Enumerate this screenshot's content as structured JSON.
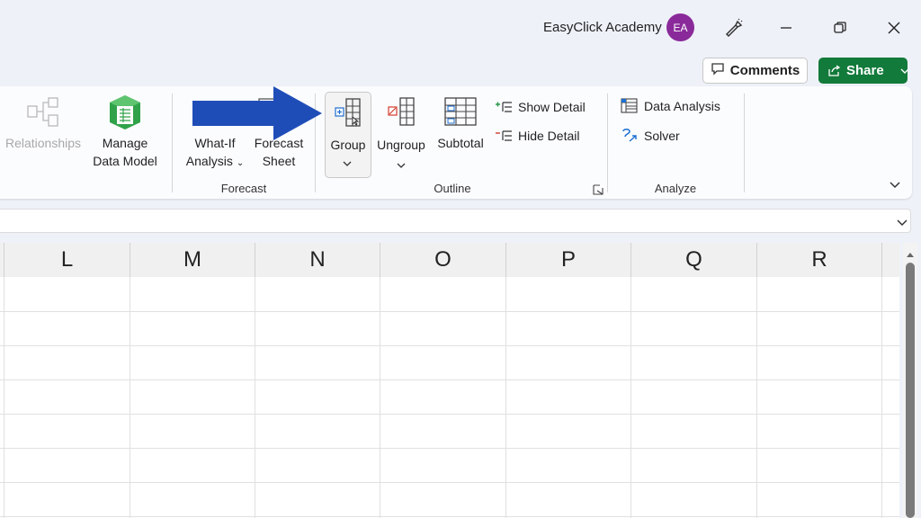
{
  "titlebar": {
    "account_name": "EasyClick Academy",
    "avatar_initials": "EA"
  },
  "actions": {
    "comments_label": "Comments",
    "share_label": "Share"
  },
  "ribbon": {
    "data_tools": {
      "relationships_label": "Relationships",
      "manage_data_model_line1": "Manage",
      "manage_data_model_line2": "Data Model"
    },
    "forecast": {
      "whatif_line1": "What-If",
      "whatif_line2": "Analysis",
      "forecast_sheet_line1": "Forecast",
      "forecast_sheet_line2": "Sheet",
      "group_label": "Forecast"
    },
    "outline": {
      "group_btn": "Group",
      "ungroup_btn": "Ungroup",
      "subtotal_btn": "Subtotal",
      "show_detail": "Show Detail",
      "hide_detail": "Hide Detail",
      "group_label": "Outline"
    },
    "analyze": {
      "data_analysis": "Data Analysis",
      "solver": "Solver",
      "group_label": "Analyze"
    }
  },
  "grid": {
    "columns": [
      "L",
      "M",
      "N",
      "O",
      "P",
      "Q",
      "R"
    ]
  },
  "colors": {
    "share_green": "#127a3a",
    "avatar_purple": "#8a2a9a",
    "annotation_arrow": "#1f4db8"
  }
}
